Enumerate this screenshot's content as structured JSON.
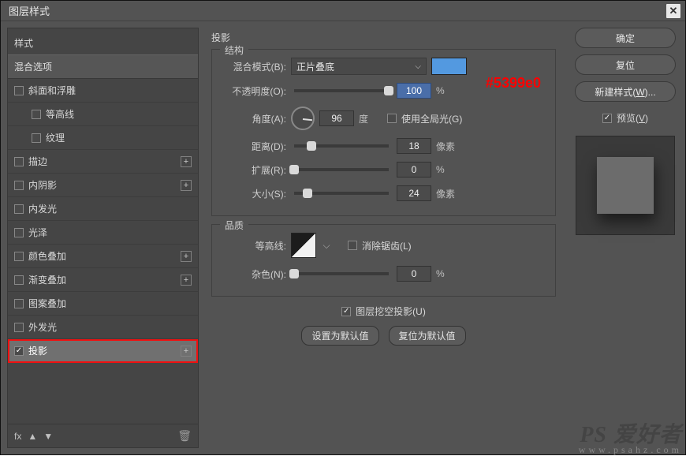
{
  "window": {
    "title": "图层样式",
    "close": "✕"
  },
  "sidebar": {
    "header": "样式",
    "section": "混合选项",
    "items": [
      {
        "label": "斜面和浮雕",
        "add": false,
        "checked": false,
        "indent": false
      },
      {
        "label": "等高线",
        "add": false,
        "checked": false,
        "indent": true
      },
      {
        "label": "纹理",
        "add": false,
        "checked": false,
        "indent": true
      },
      {
        "label": "描边",
        "add": true,
        "checked": false,
        "indent": false
      },
      {
        "label": "内阴影",
        "add": true,
        "checked": false,
        "indent": false
      },
      {
        "label": "内发光",
        "add": false,
        "checked": false,
        "indent": false
      },
      {
        "label": "光泽",
        "add": false,
        "checked": false,
        "indent": false
      },
      {
        "label": "颜色叠加",
        "add": true,
        "checked": false,
        "indent": false
      },
      {
        "label": "渐变叠加",
        "add": true,
        "checked": false,
        "indent": false
      },
      {
        "label": "图案叠加",
        "add": false,
        "checked": false,
        "indent": false
      },
      {
        "label": "外发光",
        "add": false,
        "checked": false,
        "indent": false
      },
      {
        "label": "投影",
        "add": true,
        "checked": true,
        "indent": false,
        "selected": true,
        "hl": true
      }
    ],
    "footer": {
      "fx": "fx",
      "up": "▲",
      "down": "▼",
      "trash": "🗑"
    }
  },
  "panel": {
    "title": "投影",
    "group_structure": "结构",
    "blend": {
      "label": "混合模式(B):",
      "value": "正片叠底",
      "swatch": "#5399e0",
      "overlay": "#5399e0"
    },
    "opacity": {
      "label": "不透明度(O):",
      "value": "100",
      "unit": "%",
      "pos": 100
    },
    "angle": {
      "label": "角度(A):",
      "value": "96",
      "unit": "度",
      "global_label": "使用全局光(G)",
      "global_checked": false
    },
    "distance": {
      "label": "距离(D):",
      "value": "18",
      "unit": "像素",
      "pos": 18
    },
    "spread": {
      "label": "扩展(R):",
      "value": "0",
      "unit": "%",
      "pos": 0
    },
    "size": {
      "label": "大小(S):",
      "value": "24",
      "unit": "像素",
      "pos": 14
    },
    "group_quality": "品质",
    "contour": {
      "label": "等高线:",
      "antialias_label": "消除锯齿(L)",
      "antialias_checked": false
    },
    "noise": {
      "label": "杂色(N):",
      "value": "0",
      "unit": "%",
      "pos": 0
    },
    "knockout": {
      "label": "图层挖空投影(U)",
      "checked": true
    },
    "btn_default": "设置为默认值",
    "btn_reset": "复位为默认值"
  },
  "buttons": {
    "ok": "确定",
    "cancel": "复位",
    "newstyle": "新建样式(W)...",
    "preview": "预览(V)",
    "preview_checked": true
  },
  "watermark": {
    "l1": "PS 爱好者",
    "l2": "www.psahz.com"
  }
}
